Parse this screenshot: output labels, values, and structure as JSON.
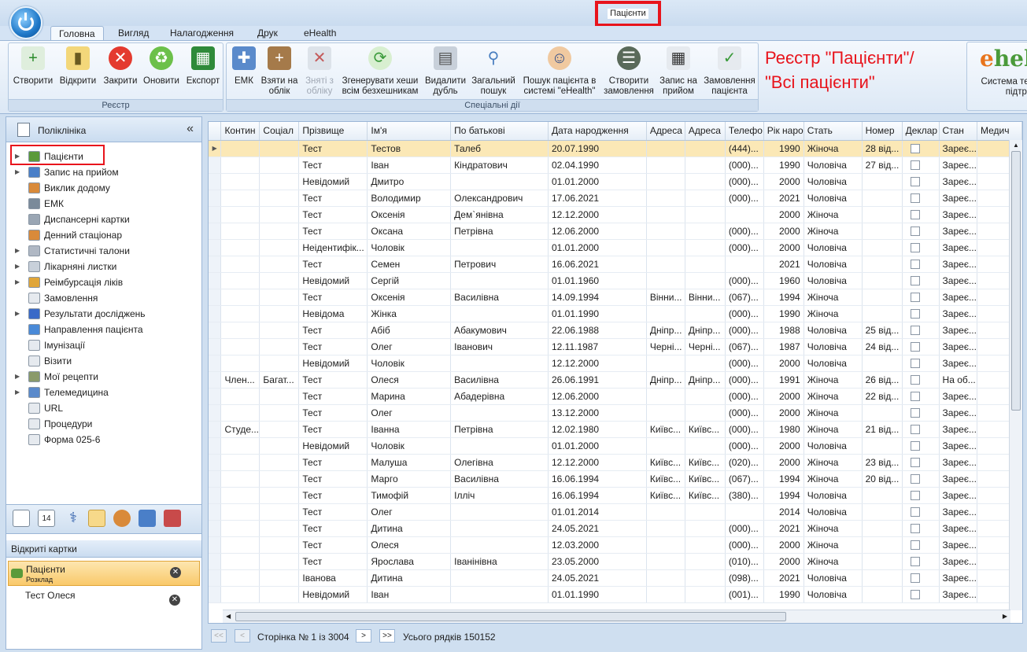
{
  "window": {
    "title": "Пацієнти"
  },
  "menu_tabs": [
    "Головна",
    "Вигляд",
    "Налагодження",
    "Друк",
    "eHealth"
  ],
  "ribbon": {
    "registry": {
      "label": "Реєстр",
      "buttons": [
        "Створити",
        "Відкрити",
        "Закрити",
        "Оновити",
        "Експорт"
      ]
    },
    "special": {
      "label": "Спеціальні дії",
      "buttons": [
        {
          "l1": "ЕМК",
          "l2": ""
        },
        {
          "l1": "Взяти на",
          "l2": "облік"
        },
        {
          "l1": "Зняті з",
          "l2": "обліку"
        },
        {
          "l1": "Згенерувати хеши",
          "l2": "всім безхешникам"
        },
        {
          "l1": "Видалити",
          "l2": "дубль"
        },
        {
          "l1": "Загальний",
          "l2": "пошук"
        },
        {
          "l1": "Пошук пацієнта в",
          "l2": "системі \"eHealth\""
        },
        {
          "l1": "Створити",
          "l2": "замовлення"
        },
        {
          "l1": "Запис на",
          "l2": "прийом"
        },
        {
          "l1": "Замовлення",
          "l2": "пацієнта"
        }
      ]
    },
    "annotation_l1": "Реєстр \"Пацієнти\"/",
    "annotation_l2": "\"Всі пацієнти\"",
    "ehealth": {
      "logo_e": "e",
      "logo_rest": "hel",
      "l1": "Система техн",
      "l2": "підтримк"
    }
  },
  "sidebar": {
    "title": "Поліклініка",
    "items": [
      {
        "label": "Пацієнти",
        "arrow": true,
        "icon": "patients-icon"
      },
      {
        "label": "Запис на прийом",
        "arrow": true,
        "icon": "calendar-icon"
      },
      {
        "label": "Виклик додому",
        "arrow": false,
        "icon": "doctor-icon"
      },
      {
        "label": "ЕМК",
        "arrow": false,
        "icon": "card-icon"
      },
      {
        "label": "Диспансерні картки",
        "arrow": false,
        "icon": "cards-icon"
      },
      {
        "label": "Денний стаціонар",
        "arrow": false,
        "icon": "doctor-icon"
      },
      {
        "label": "Статистичні талони",
        "arrow": true,
        "icon": "stack-icon"
      },
      {
        "label": "Лікарняні листки",
        "arrow": true,
        "icon": "sheet-icon"
      },
      {
        "label": "Реімбурсація ліків",
        "arrow": true,
        "icon": "pill-icon"
      },
      {
        "label": "Замовлення",
        "arrow": false,
        "icon": "document-icon"
      },
      {
        "label": "Результати досліджень",
        "arrow": true,
        "icon": "flask-icon"
      },
      {
        "label": "Направлення пацієнта",
        "arrow": false,
        "icon": "arrow-icon"
      },
      {
        "label": "Імунізації",
        "arrow": false,
        "icon": "document-icon"
      },
      {
        "label": "Візити",
        "arrow": false,
        "icon": "document-icon"
      },
      {
        "label": "Мої рецепти",
        "arrow": true,
        "icon": "prescription-icon"
      },
      {
        "label": "Телемедицина",
        "arrow": true,
        "icon": "people-icon"
      },
      {
        "label": "URL",
        "arrow": false,
        "icon": "document-icon"
      },
      {
        "label": "Процедури",
        "arrow": false,
        "icon": "document-icon"
      },
      {
        "label": "Форма 025-6",
        "arrow": false,
        "icon": "document-icon"
      }
    ]
  },
  "opened_cards": {
    "title": "Відкриті картки",
    "items": [
      {
        "name": "Пацієнти",
        "sub": "Розклад",
        "active": true
      },
      {
        "name": "Тест Олеся",
        "sub": "",
        "active": false
      }
    ]
  },
  "grid": {
    "columns": [
      "Контин",
      "Соціал",
      "Прізвище",
      "Ім'я",
      "По батькові",
      "Дата народження",
      "Адреса",
      "Адреса",
      "Телефо",
      "Рік наро",
      "Стать",
      "Номер",
      "Деклар",
      "Стан",
      "Медич"
    ],
    "rows": [
      [
        "",
        "",
        "Тест",
        "Тестов",
        "Талеб",
        "20.07.1990",
        "",
        "",
        "(444)...",
        "1990",
        "Жіноча",
        "28 від...",
        "",
        "Зареє..."
      ],
      [
        "",
        "",
        "Тест",
        "Іван",
        "Кіндратович",
        "02.04.1990",
        "",
        "",
        "(000)...",
        "1990",
        "Чоловіча",
        "27 від...",
        "",
        "Зареє..."
      ],
      [
        "",
        "",
        "Невідомий",
        "Дмитро",
        "",
        "01.01.2000",
        "",
        "",
        "(000)...",
        "2000",
        "Чоловіча",
        "",
        "",
        "Зареє..."
      ],
      [
        "",
        "",
        "Тест",
        "Володимир",
        "Олександрович",
        "17.06.2021",
        "",
        "",
        "(000)...",
        "2021",
        "Чоловіча",
        "",
        "",
        "Зареє..."
      ],
      [
        "",
        "",
        "Тест",
        "Оксенія",
        "Дем`янівна",
        "12.12.2000",
        "",
        "",
        "",
        "2000",
        "Жіноча",
        "",
        "",
        "Зареє..."
      ],
      [
        "",
        "",
        "Тест",
        "Оксана",
        "Петрівна",
        "12.06.2000",
        "",
        "",
        "(000)...",
        "2000",
        "Жіноча",
        "",
        "",
        "Зареє..."
      ],
      [
        "",
        "",
        "Неідентифік...",
        "Чоловік",
        "",
        "01.01.2000",
        "",
        "",
        "(000)...",
        "2000",
        "Чоловіча",
        "",
        "",
        "Зареє..."
      ],
      [
        "",
        "",
        "Тест",
        "Семен",
        "Петрович",
        "16.06.2021",
        "",
        "",
        "",
        "2021",
        "Чоловіча",
        "",
        "",
        "Зареє..."
      ],
      [
        "",
        "",
        "Невідомий",
        "Сергій",
        "",
        "01.01.1960",
        "",
        "",
        "(000)...",
        "1960",
        "Чоловіча",
        "",
        "",
        "Зареє..."
      ],
      [
        "",
        "",
        "Тест",
        "Оксенія",
        "Василівна",
        "14.09.1994",
        "Вінни...",
        "Вінни...",
        "(067)...",
        "1994",
        "Жіноча",
        "",
        "",
        "Зареє..."
      ],
      [
        "",
        "",
        "Невідома",
        "Жінка",
        "",
        "01.01.1990",
        "",
        "",
        "(000)...",
        "1990",
        "Жіноча",
        "",
        "",
        "Зареє..."
      ],
      [
        "",
        "",
        "Тест",
        "Абіб",
        "Абакумович",
        "22.06.1988",
        "Дніпр...",
        "Дніпр...",
        "(000)...",
        "1988",
        "Чоловіча",
        "25 від...",
        "",
        "Зареє..."
      ],
      [
        "",
        "",
        "Тест",
        "Олег",
        "Іванович",
        "12.11.1987",
        "Черні...",
        "Черні...",
        "(067)...",
        "1987",
        "Чоловіча",
        "24 від...",
        "",
        "Зареє..."
      ],
      [
        "",
        "",
        "Невідомий",
        "Чоловік",
        "",
        "12.12.2000",
        "",
        "",
        "(000)...",
        "2000",
        "Чоловіча",
        "",
        "",
        "Зареє..."
      ],
      [
        "Член...",
        "Багат...",
        "Тест",
        "Олеся",
        "Василівна",
        "26.06.1991",
        "Дніпр...",
        "Дніпр...",
        "(000)...",
        "1991",
        "Жіноча",
        "26 від...",
        "",
        "На об..."
      ],
      [
        "",
        "",
        "Тест",
        "Марина",
        "Абадерівна",
        "12.06.2000",
        "",
        "",
        "(000)...",
        "2000",
        "Жіноча",
        "22 від...",
        "",
        "Зареє..."
      ],
      [
        "",
        "",
        "Тест",
        "Олег",
        "",
        "13.12.2000",
        "",
        "",
        "(000)...",
        "2000",
        "Жіноча",
        "",
        "",
        "Зареє..."
      ],
      [
        "Студе...",
        "",
        "Тест",
        "Іванна",
        "Петрівна",
        "12.02.1980",
        "Київс...",
        "Київс...",
        "(000)...",
        "1980",
        "Жіноча",
        "21 від...",
        "",
        "Зареє..."
      ],
      [
        "",
        "",
        "Невідомий",
        "Чоловік",
        "",
        "01.01.2000",
        "",
        "",
        "(000)...",
        "2000",
        "Чоловіча",
        "",
        "",
        "Зареє..."
      ],
      [
        "",
        "",
        "Тест",
        "Малуша",
        "Олегівна",
        "12.12.2000",
        "Київс...",
        "Київс...",
        "(020)...",
        "2000",
        "Жіноча",
        "23 від...",
        "",
        "Зареє..."
      ],
      [
        "",
        "",
        "Тест",
        "Марго",
        "Василівна",
        "16.06.1994",
        "Київс...",
        "Київс...",
        "(067)...",
        "1994",
        "Жіноча",
        "20 від...",
        "",
        "Зареє..."
      ],
      [
        "",
        "",
        "Тест",
        "Тимофій",
        "Ілліч",
        "16.06.1994",
        "Київс...",
        "Київс...",
        "(380)...",
        "1994",
        "Чоловіча",
        "",
        "",
        "Зареє..."
      ],
      [
        "",
        "",
        "Тест",
        "Олег",
        "",
        "01.01.2014",
        "",
        "",
        "",
        "2014",
        "Чоловіча",
        "",
        "",
        "Зареє..."
      ],
      [
        "",
        "",
        "Тест",
        "Дитина",
        "",
        "24.05.2021",
        "",
        "",
        "(000)...",
        "2021",
        "Жіноча",
        "",
        "",
        "Зареє..."
      ],
      [
        "",
        "",
        "Тест",
        "Олеся",
        "",
        "12.03.2000",
        "",
        "",
        "(000)...",
        "2000",
        "Жіноча",
        "",
        "",
        "Зареє..."
      ],
      [
        "",
        "",
        "Тест",
        "Ярослава",
        "Іванінівна",
        "23.05.2000",
        "",
        "",
        "(010)...",
        "2000",
        "Жіноча",
        "",
        "",
        "Зареє..."
      ],
      [
        "",
        "",
        "Іванова",
        "Дитина",
        "",
        "24.05.2021",
        "",
        "",
        "(098)...",
        "2021",
        "Чоловіча",
        "",
        "",
        "Зареє..."
      ],
      [
        "",
        "",
        "Невідомий",
        "Іван",
        "",
        "01.01.1990",
        "",
        "",
        "(001)...",
        "1990",
        "Чоловіча",
        "",
        "",
        "Зареє..."
      ]
    ]
  },
  "pager": {
    "first": "<<",
    "prev": "<",
    "next": ">",
    "last": ">>",
    "page_text": "Сторінка № 1 із 3004",
    "total_text": "Усього рядків 150152"
  }
}
